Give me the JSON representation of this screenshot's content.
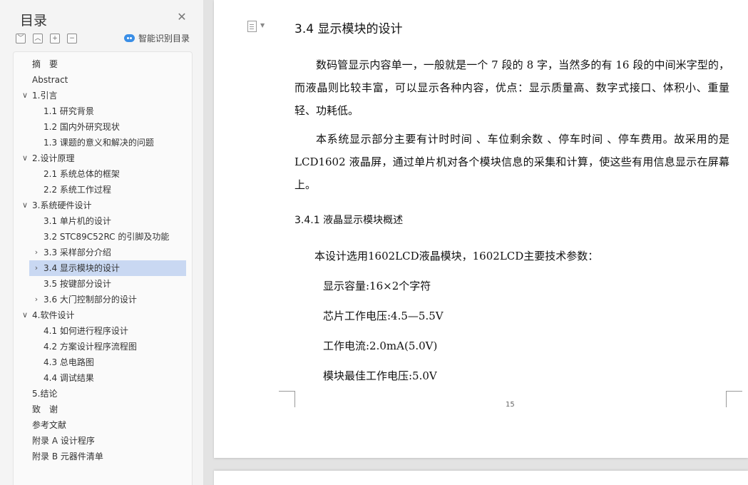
{
  "sidebar": {
    "title": "目录",
    "close_icon": "close-icon",
    "tools": [
      {
        "icon": "collapse-all-icon",
        "glyph": "﹀"
      },
      {
        "icon": "expand-icon",
        "glyph": "︿"
      },
      {
        "icon": "add-icon",
        "glyph": "+"
      },
      {
        "icon": "remove-icon",
        "glyph": "−"
      }
    ],
    "smart_toc_label": "智能识别目录",
    "smart_toc_icon": "ai-recognize-icon"
  },
  "toc": [
    {
      "label": "摘　要",
      "level": 0,
      "arrow": ""
    },
    {
      "label": "Abstract",
      "level": 0,
      "arrow": ""
    },
    {
      "label": "1.引言",
      "level": 0,
      "arrow": "expanded"
    },
    {
      "label": "1.1  研究背景",
      "level": 1,
      "arrow": ""
    },
    {
      "label": "1.2  国内外研究现状",
      "level": 1,
      "arrow": ""
    },
    {
      "label": "1.3  课题的意义和解决的问题",
      "level": 1,
      "arrow": ""
    },
    {
      "label": "2.设计原理",
      "level": 0,
      "arrow": "expanded"
    },
    {
      "label": "2.1  系统总体的框架",
      "level": 1,
      "arrow": ""
    },
    {
      "label": "2.2  系统工作过程",
      "level": 1,
      "arrow": ""
    },
    {
      "label": "3.系统硬件设计",
      "level": 0,
      "arrow": "expanded"
    },
    {
      "label": "3.1  单片机的设计",
      "level": 1,
      "arrow": ""
    },
    {
      "label": "3.2 STC89C52RC 的引脚及功能",
      "level": 1,
      "arrow": ""
    },
    {
      "label": "3.3  采样部分介绍",
      "level": 1,
      "arrow": "collapsed"
    },
    {
      "label": "3.4  显示模块的设计",
      "level": 1,
      "arrow": "collapsed",
      "selected": true
    },
    {
      "label": "3.5  按键部分设计",
      "level": 1,
      "arrow": ""
    },
    {
      "label": "3.6  大门控制部分的设计",
      "level": 1,
      "arrow": "collapsed"
    },
    {
      "label": "4.软件设计",
      "level": 0,
      "arrow": "expanded"
    },
    {
      "label": "4.1  如何进行程序设计",
      "level": 1,
      "arrow": ""
    },
    {
      "label": "4.2  方案设计程序流程图",
      "level": 1,
      "arrow": ""
    },
    {
      "label": "4.3  总电路图",
      "level": 1,
      "arrow": ""
    },
    {
      "label": "4.4  调试结果",
      "level": 1,
      "arrow": ""
    },
    {
      "label": "5.结论",
      "level": 0,
      "arrow": ""
    },
    {
      "label": "致　谢",
      "level": 0,
      "arrow": ""
    },
    {
      "label": "参考文献",
      "level": 0,
      "arrow": ""
    },
    {
      "label": "附录 A 设计程序",
      "level": 0,
      "arrow": ""
    },
    {
      "label": "附录 B 元器件清单",
      "level": 0,
      "arrow": ""
    }
  ],
  "document": {
    "heading": "3.4  显示模块的设计",
    "para1": "数码管显示内容单一，一般就是一个 7 段的 8 字，当然多的有 16 段的中间米字型的，而液晶则比较丰富，可以显示各种内容，优点：显示质量高、数字式接口、体积小、重量轻、功耗低。",
    "para2": "本系统显示部分主要有计时时间 、车位剩余数 、停车时间 、停车费用。故采用的是 LCD1602 液晶屏，通过单片机对各个模块信息的采集和计算，使这些有用信息显示在屏幕上。",
    "subheading": "3.4.1  液晶显示模块概述",
    "intro": "本设计选用1602LCD液晶模块，1602LCD主要技术参数：",
    "specs": [
      "显示容量:16×2个字符",
      "芯片工作电压:4.5—5.5V",
      "工作电流:2.0mA(5.0V)",
      "模块最佳工作电压:5.0V"
    ],
    "page_number": "15"
  }
}
